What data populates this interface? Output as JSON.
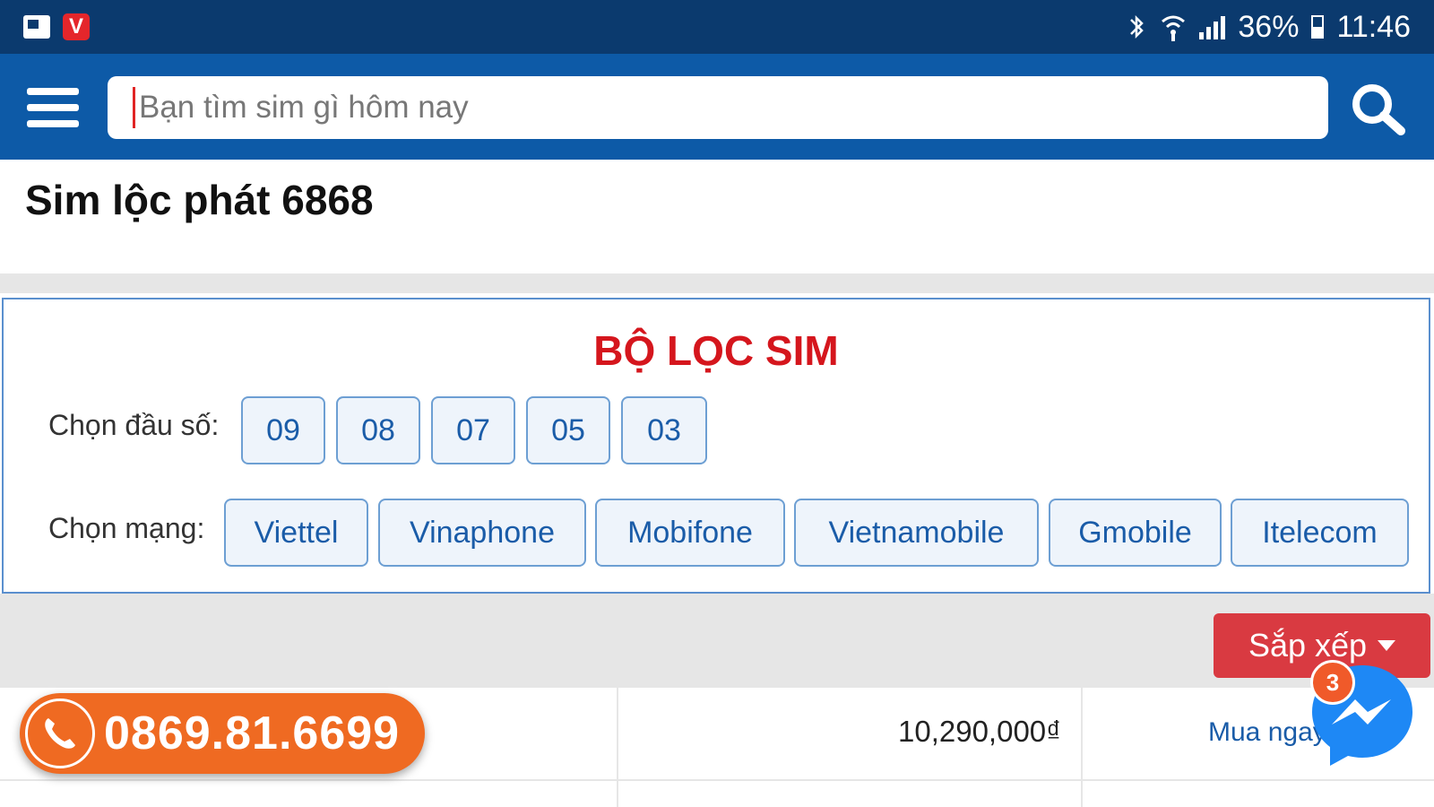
{
  "status_bar": {
    "battery": "36%",
    "time": "11:46",
    "icons": [
      "app-notification-icon",
      "v-app-icon",
      "bluetooth-icon",
      "wifi-icon",
      "signal-icon",
      "battery-icon"
    ]
  },
  "header": {
    "search_placeholder": "Bạn tìm sim gì hôm nay",
    "menu_icon": "hamburger-menu-icon",
    "search_icon": "search-icon"
  },
  "page_title": "Sim lộc phát 6868",
  "filter": {
    "title": "BỘ LỌC SIM",
    "prefix_label": "Chọn đầu số:",
    "prefixes": [
      "09",
      "08",
      "07",
      "05",
      "03"
    ],
    "network_label": "Chọn mạng:",
    "networks": [
      "Viettel",
      "Vinaphone",
      "Mobifone",
      "Vietnamobile",
      "Gmobile",
      "Itelecom"
    ]
  },
  "sort": {
    "label": "Sắp xếp"
  },
  "list": {
    "rows": [
      {
        "number": "0869.81.6699",
        "price": "10,290,000₫",
        "action": "Mua ngay"
      }
    ]
  },
  "floating": {
    "hotline": "0869.81.6699",
    "messenger_badge": "3"
  },
  "colors": {
    "status_bar": "#0b3a6e",
    "header": "#0d5aa7",
    "title_red": "#d5161d",
    "chip_border": "#6d9fd3",
    "sort_button": "#d93a41",
    "hotline_orange": "#ef6a22",
    "messenger_blue": "#1e88f5"
  }
}
